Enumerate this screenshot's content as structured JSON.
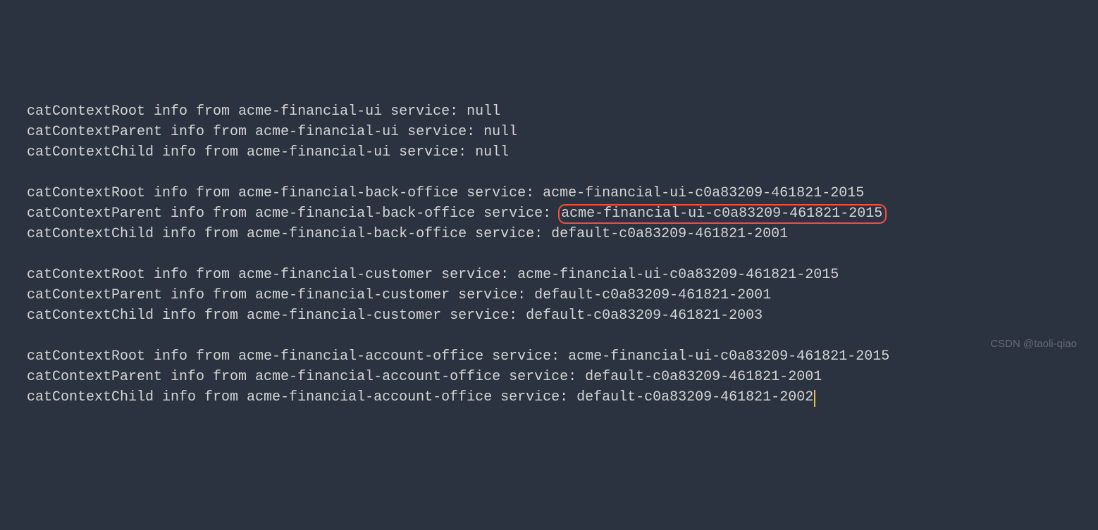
{
  "logs": {
    "groups": [
      {
        "lines": [
          {
            "prefix": "catContextRoot info from acme-financial-ui service: ",
            "value": "null",
            "highlight": false
          },
          {
            "prefix": "catContextParent info from acme-financial-ui service: ",
            "value": "null",
            "highlight": false
          },
          {
            "prefix": "catContextChild info from acme-financial-ui service: ",
            "value": "null",
            "highlight": false
          }
        ]
      },
      {
        "lines": [
          {
            "prefix": "catContextRoot info from acme-financial-back-office service: ",
            "value": "acme-financial-ui-c0a83209-461821-2015",
            "highlight": false
          },
          {
            "prefix": "catContextParent info from acme-financial-back-office service: ",
            "value": "acme-financial-ui-c0a83209-461821-2015",
            "highlight": true
          },
          {
            "prefix": "catContextChild info from acme-financial-back-office service: ",
            "value": "default-c0a83209-461821-2001",
            "highlight": false
          }
        ]
      },
      {
        "lines": [
          {
            "prefix": "catContextRoot info from acme-financial-customer service: ",
            "value": "acme-financial-ui-c0a83209-461821-2015",
            "highlight": false
          },
          {
            "prefix": "catContextParent info from acme-financial-customer service: ",
            "value": "default-c0a83209-461821-2001",
            "highlight": false
          },
          {
            "prefix": "catContextChild info from acme-financial-customer service: ",
            "value": "default-c0a83209-461821-2003",
            "highlight": false
          }
        ]
      },
      {
        "lines": [
          {
            "prefix": "catContextRoot info from acme-financial-account-office service: ",
            "value": "acme-financial-ui-c0a83209-461821-2015",
            "highlight": false
          },
          {
            "prefix": "catContextParent info from acme-financial-account-office service: ",
            "value": "default-c0a83209-461821-2001",
            "highlight": false
          },
          {
            "prefix": "catContextChild info from acme-financial-account-office service: ",
            "value": "default-c0a83209-461821-2002",
            "highlight": false,
            "cursor": true
          }
        ]
      }
    ]
  },
  "watermark": "CSDN @taoli-qiao"
}
